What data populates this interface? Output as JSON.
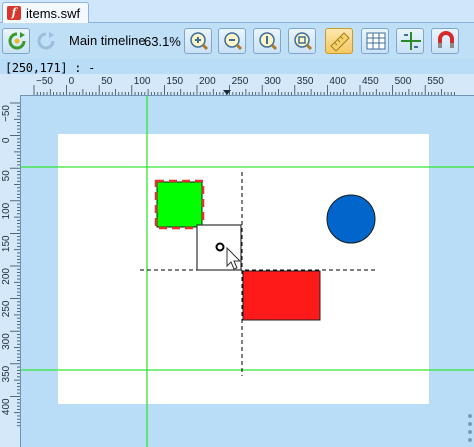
{
  "tab": {
    "title": "items.swf",
    "icon": "flash-file-icon"
  },
  "toolbar": {
    "timeline_label": "Main timeline",
    "zoom": "63.1%",
    "buttons": [
      {
        "icon": "refresh-icon",
        "state": "normal"
      },
      {
        "icon": "refresh-disabled-icon",
        "state": "disabled"
      },
      {
        "icon": "zoom-in-icon",
        "state": "normal"
      },
      {
        "icon": "zoom-out-icon",
        "state": "normal"
      },
      {
        "icon": "zoom-actual-icon",
        "state": "normal"
      },
      {
        "icon": "zoom-fit-icon",
        "state": "normal"
      },
      {
        "icon": "ruler-icon",
        "state": "active"
      },
      {
        "icon": "grid-icon",
        "state": "normal"
      },
      {
        "icon": "guides-icon",
        "state": "normal"
      },
      {
        "icon": "snap-magnet-icon",
        "state": "normal"
      }
    ]
  },
  "status": {
    "coords": "[250,171] : -"
  },
  "ruler": {
    "h_labels": [
      "−50",
      "0",
      "50",
      "100",
      "150",
      "200",
      "250",
      "300",
      "350",
      "400",
      "450",
      "500",
      "550"
    ],
    "v_labels": [
      "−50",
      "0",
      "50",
      "100",
      "150",
      "200",
      "250",
      "300",
      "350",
      "400"
    ]
  },
  "colors": {
    "guide": "#33e633",
    "green_square": "#00ff00",
    "red_rect": "#ff1a1a",
    "blue_circle": "#0066cc",
    "selection_dash": "#e03030"
  }
}
